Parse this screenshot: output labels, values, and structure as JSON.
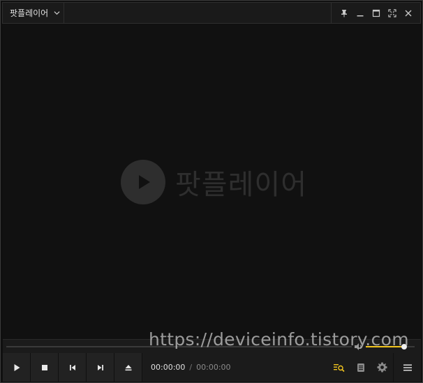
{
  "app": {
    "menu_label": "팟플레이어",
    "logo_text": "팟플레이어"
  },
  "playback": {
    "current_time": "00:00:00",
    "separator": "/",
    "total_time": "00:00:00",
    "seek_position": 0,
    "volume_level": 0.78
  },
  "watermark": "https://deviceinfo.tistory.com",
  "colors": {
    "accent": "#f2c51f",
    "background": "#111111",
    "bar": "#1b1b1b"
  }
}
